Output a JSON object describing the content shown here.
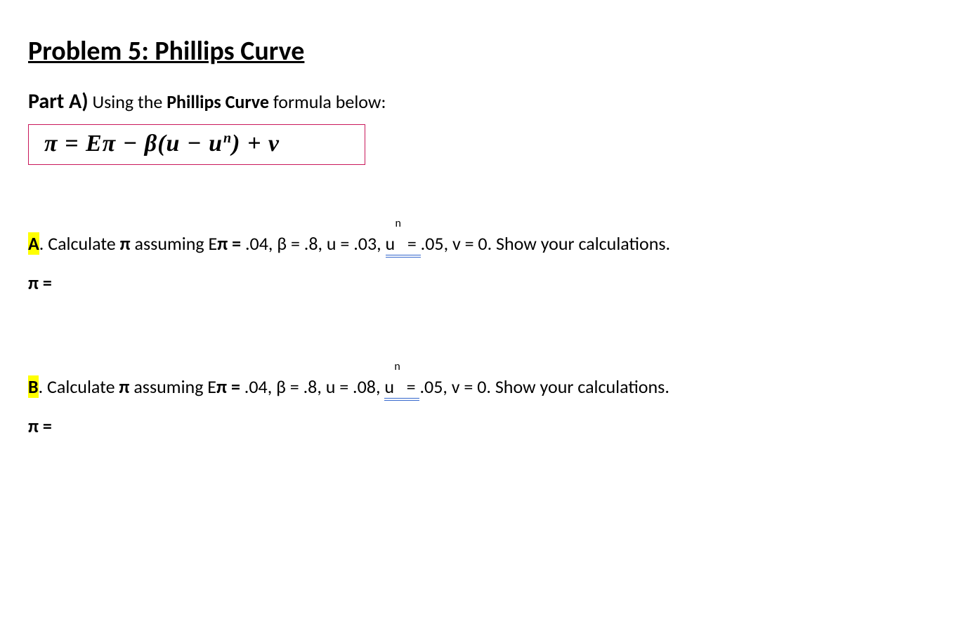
{
  "title": "Problem 5:   Phillips Curve",
  "partA": {
    "label": "Part A)",
    "text_prefix": " Using the ",
    "bold_term": "Phillips Curve",
    "text_suffix": " formula below:"
  },
  "formula": {
    "lhs": "π",
    "eq1": " = ",
    "Epi": "Eπ",
    "minus1": " − ",
    "beta": "β",
    "open": "(",
    "u": "u",
    "minus2": " − ",
    "u2": "u",
    "sup_n": "n",
    "close": ")",
    "plus": " + ",
    "nu": "ν"
  },
  "qA": {
    "marker": "A",
    "dot": ". ",
    "t1": "Calculate ",
    "pi": "π",
    "t2": " assuming E",
    "pi2": "π = ",
    "v_epi": ".04, β = .8, u = .03, ",
    "un_u": "u",
    "un_sup": "n",
    "un_eq": "   = ",
    "v_un": ".05, v = 0. Show your calculations.",
    "answer_label": "π ="
  },
  "qB": {
    "marker": "B",
    "dot": ". ",
    "t1": "Calculate ",
    "pi": "π",
    "t2": " assuming E",
    "pi2": "π = ",
    "v_epi": ".04, β = .8, u = .08, ",
    "un_u": "u",
    "un_sup": "n",
    "un_eq": "   = ",
    "v_un": ".05, v = 0. Show your calculations.",
    "answer_label": "π ="
  }
}
